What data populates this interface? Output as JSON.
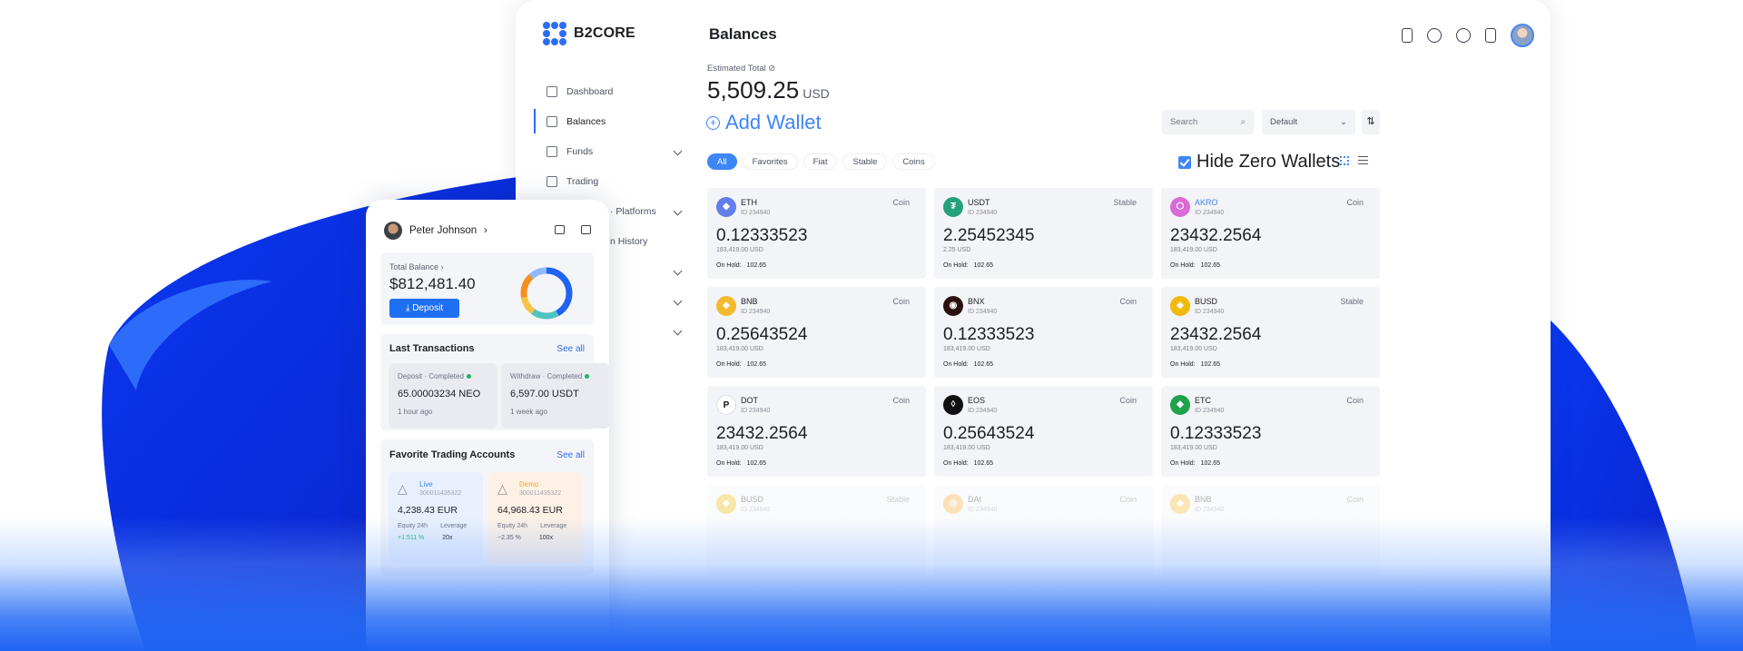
{
  "brand": {
    "name": "B2CORE"
  },
  "colors": {
    "accent": "#3d86f5",
    "brand_blue": "#1f63f3"
  },
  "sidebar": {
    "items": [
      {
        "label": "Dashboard",
        "icon": "dashboard-icon"
      },
      {
        "label": "Balances",
        "icon": "wallet-icon",
        "active": true
      },
      {
        "label": "Funds",
        "icon": "transfer-icon"
      },
      {
        "label": "Trading",
        "icon": "chart-icon"
      },
      {
        "label": "Platforms",
        "icon": "platforms-icon"
      },
      {
        "label": "History",
        "icon": "history-icon"
      }
    ],
    "partial_platforms": "· Platforms",
    "partial_history": "n History"
  },
  "header": {
    "title": "Balances"
  },
  "estimate": {
    "label": "Estimated Total",
    "value": "5,509.25",
    "currency": "USD"
  },
  "add_wallet": {
    "label": "Add Wallet"
  },
  "search": {
    "placeholder": "Search"
  },
  "sort": {
    "selected": "Default"
  },
  "filters": [
    "All",
    "Favorites",
    "Fiat",
    "Stable",
    "Coins"
  ],
  "hide_zero": {
    "label": "Hide Zero Wallets"
  },
  "wallets": [
    {
      "name": "ETH",
      "id": "ID 234940",
      "type": "Coin",
      "amount": "0.12333523",
      "usd": "183,419.00 USD",
      "hold_label": "On Hold:",
      "hold": "102.65",
      "color": "#627eea",
      "glyph": "◆"
    },
    {
      "name": "USDT",
      "id": "ID 234940",
      "type": "Stable",
      "amount": "2.25452345",
      "usd": "2.25 USD",
      "hold_label": "On Hold:",
      "hold": "102.65",
      "color": "#26a17b",
      "glyph": "₮"
    },
    {
      "name": "AKRO",
      "id": "ID 234940",
      "type": "Coin",
      "amount": "23432.2564",
      "usd": "183,419.00 USD",
      "hold_label": "On Hold:",
      "hold": "102.65",
      "color": "#d86bd6",
      "glyph": "⬡"
    },
    {
      "name": "BNB",
      "id": "ID 234940",
      "type": "Coin",
      "amount": "0.25643524",
      "usd": "183,419.00 USD",
      "hold_label": "On Hold:",
      "hold": "102.65",
      "color": "#f3ba2f",
      "glyph": "◈"
    },
    {
      "name": "BNX",
      "id": "ID 234940",
      "type": "Coin",
      "amount": "0.12333523",
      "usd": "183,419.00 USD",
      "hold_label": "On Hold:",
      "hold": "102.65",
      "color": "#2a1010",
      "glyph": "◉"
    },
    {
      "name": "BUSD",
      "id": "ID 234940",
      "type": "Stable",
      "amount": "23432.2564",
      "usd": "183,419.00 USD",
      "hold_label": "On Hold:",
      "hold": "102.65",
      "color": "#f0b90b",
      "glyph": "◈"
    },
    {
      "name": "DOT",
      "id": "ID 234940",
      "type": "Coin",
      "amount": "23432.2564",
      "usd": "183,419.00 USD",
      "hold_label": "On Hold:",
      "hold": "102.65",
      "color": "#ffffff",
      "glyph": "P"
    },
    {
      "name": "EOS",
      "id": "ID 234940",
      "type": "Coin",
      "amount": "0.25643524",
      "usd": "183,419.00 USD",
      "hold_label": "On Hold:",
      "hold": "102.65",
      "color": "#111111",
      "glyph": "◊"
    },
    {
      "name": "ETC",
      "id": "ID 234940",
      "type": "Coin",
      "amount": "0.12333523",
      "usd": "183,419.00 USD",
      "hold_label": "On Hold:",
      "hold": "102.65",
      "color": "#1ea34a",
      "glyph": "◆"
    },
    {
      "name": "BUSD",
      "id": "ID 234940",
      "type": "Stable",
      "color": "#f0b90b",
      "glyph": "◈"
    },
    {
      "name": "DAI",
      "id": "ID 234940",
      "type": "Coin",
      "color": "#f5ac37",
      "glyph": "◎"
    },
    {
      "name": "BNB",
      "id": "ID 234940",
      "type": "Coin",
      "color": "#f3ba2f",
      "glyph": "◈"
    }
  ],
  "mobile": {
    "user": "Peter Johnson",
    "total_label": "Total Balance",
    "total_value": "$812,481.40",
    "deposit": "Deposit",
    "last_tx_title": "Last Transactions",
    "see_all": "See all",
    "transactions": [
      {
        "status": "Deposit · Completed",
        "amount": "65.00003234 NEO",
        "time": "1 hour ago"
      },
      {
        "status": "Withdraw · Completed",
        "amount": "6,597.00 USDT",
        "time": "1 week ago"
      }
    ],
    "fav_title": "Favorite Trading Accounts",
    "accounts": [
      {
        "kind": "Live",
        "number": "300011435322",
        "balance": "4,238.43 EUR",
        "equity_label": "Equity 24h",
        "leverage_label": "Leverage",
        "equity": "+1.511 %",
        "leverage": "20x",
        "kind_color": "#3d86f5",
        "equity_color": "#1fb36b",
        "bg": "#e8f0fd"
      },
      {
        "kind": "Demo",
        "number": "300011435322",
        "balance": "64,968.43 EUR",
        "equity_label": "Equity 24h",
        "leverage_label": "Leverage",
        "equity": "−2.35 %",
        "leverage": "100x",
        "kind_color": "#f5a623",
        "equity_color": "#4b5060",
        "bg": "#fdf1e6"
      }
    ],
    "donut": [
      0.42,
      0.18,
      0.12,
      0.16,
      0.12
    ]
  }
}
